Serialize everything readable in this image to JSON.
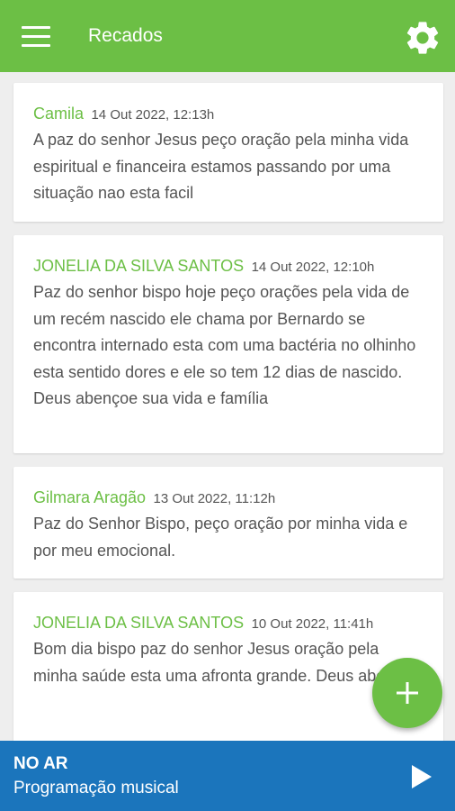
{
  "header": {
    "title": "Recados",
    "menu_icon": "hamburger-menu-icon",
    "settings_icon": "gear-icon"
  },
  "messages": [
    {
      "author": "Camila",
      "date": "14 Out 2022, 12:13h",
      "text": "A paz do senhor Jesus peço oração pela minha vida espiritual e financeira estamos passando por uma situação nao esta facil"
    },
    {
      "author": "JONELIA DA SILVA SANTOS",
      "date": "14 Out 2022, 12:10h",
      "text": "Paz do senhor bispo hoje peço orações pela vida de um recém nascido ele chama por Bernardo se encontra internado esta com uma bactéria no olhinho esta sentido dores e ele so tem 12 dias de nascido. Deus abençoe sua vida e família"
    },
    {
      "author": "Gilmara Aragão",
      "date": "13 Out 2022, 11:12h",
      "text": "Paz do Senhor Bispo, peço oração por minha vida e por meu emocional."
    },
    {
      "author": "JONELIA DA SILVA SANTOS",
      "date": "10 Out 2022, 11:41h",
      "text": "Bom dia bispo paz do senhor Jesus oração pela minha saúde esta uma afronta grande. Deus abençoe"
    }
  ],
  "fab": {
    "icon": "plus-icon"
  },
  "player": {
    "status": "NO AR",
    "program": "Programação musical",
    "play_icon": "play-icon"
  },
  "colors": {
    "primary_green": "#6cbf45",
    "player_blue": "#1b75bc",
    "background": "#eeeeee",
    "text_gray": "#555555"
  }
}
